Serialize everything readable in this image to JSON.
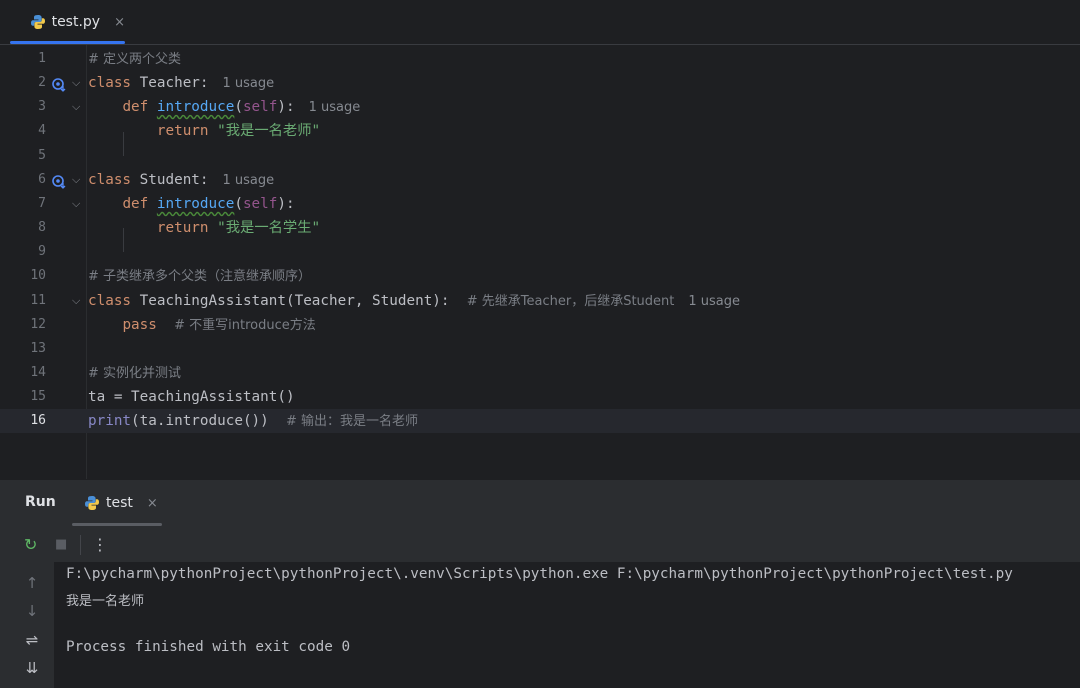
{
  "editor_tab": {
    "label": "test.py",
    "close": "×"
  },
  "code_lines": [
    {
      "n": "1",
      "comment": "# 定义两个父类"
    },
    {
      "n": "2",
      "kw": "class",
      "name": " Teacher:",
      "hint": "1 usage"
    },
    {
      "n": "3",
      "indent": "    ",
      "kw": "def",
      "fn": "introduce",
      "open": "(",
      "self": "self",
      "close": "):",
      "hint": "1 usage"
    },
    {
      "n": "4",
      "indent": "        ",
      "kw": "return",
      "str": "\"我是一名老师\""
    },
    {
      "n": "5"
    },
    {
      "n": "6",
      "kw": "class",
      "name": " Student:",
      "hint": "1 usage"
    },
    {
      "n": "7",
      "indent": "    ",
      "kw": "def",
      "fn": "introduce",
      "open": "(",
      "self": "self",
      "close": "):"
    },
    {
      "n": "8",
      "indent": "        ",
      "kw": "return",
      "str": "\"我是一名学生\""
    },
    {
      "n": "9"
    },
    {
      "n": "10",
      "comment": "# 子类继承多个父类（注意继承顺序）"
    },
    {
      "n": "11",
      "kw": "class",
      "name": " TeachingAssistant(Teacher, Student):",
      "comment": "# 先继承Teacher，后继承Student",
      "hint": "1 usage"
    },
    {
      "n": "12",
      "indent": "    ",
      "kw": "pass",
      "comment": "# 不重写introduce方法"
    },
    {
      "n": "13"
    },
    {
      "n": "14",
      "comment": "# 实例化并测试"
    },
    {
      "n": "15",
      "plain": "ta = TeachingAssistant()"
    },
    {
      "n": "16",
      "builtin": "print",
      "plain": "(ta.introduce())",
      "comment": "# 输出：我是一名老师"
    }
  ],
  "run_panel": {
    "title": "Run",
    "tab_label": "test",
    "tab_close": "×",
    "toolbar": {
      "rerun": "↻",
      "stop": "■",
      "more": "⋮"
    },
    "side": {
      "up": "↑",
      "down": "↓",
      "wrap": "⇌",
      "scroll_end": "⇊"
    },
    "console": [
      "F:\\pycharm\\pythonProject\\pythonProject\\.venv\\Scripts\\python.exe F:\\pycharm\\pythonProject\\pythonProject\\test.py",
      "我是一名老师",
      "",
      "Process finished with exit code 0"
    ]
  }
}
